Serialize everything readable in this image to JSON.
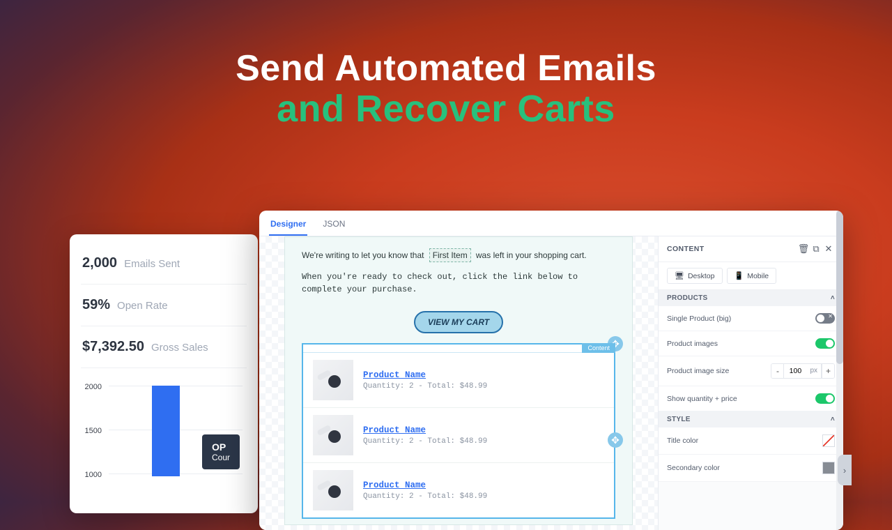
{
  "headline": {
    "line1": "Send Automated Emails",
    "line2": "and Recover Carts"
  },
  "stats": {
    "emails_sent": {
      "value": "2,000",
      "label": "Emails Sent"
    },
    "open_rate": {
      "value": "59%",
      "label": "Open Rate"
    },
    "gross_sales": {
      "value": "$7,392.50",
      "label": "Gross Sales"
    }
  },
  "chart_data": {
    "type": "bar",
    "y_ticks": [
      "2000",
      "1500",
      "1000"
    ],
    "ylim": [
      1000,
      2000
    ],
    "series": [
      {
        "name": "",
        "values": [
          2000
        ]
      }
    ],
    "tooltip": {
      "title": "OP",
      "subtitle": "Cour"
    }
  },
  "designer": {
    "tabs": [
      "Designer",
      "JSON"
    ],
    "active_tab": "Designer",
    "mail_line1_a": "We're writing to let you know that",
    "mail_tag": "First Item",
    "mail_line1_b": "was left in your shopping cart.",
    "mail_line2": "When you're ready to check out, click the link below to complete your purchase.",
    "cta": "VIEW MY CART",
    "content_badge": "Content",
    "products": [
      {
        "name": "Product Name",
        "meta": "Quantity: 2 - Total: $48.99"
      },
      {
        "name": "Product Name",
        "meta": "Quantity: 2 - Total: $48.99"
      },
      {
        "name": "Product Name",
        "meta": "Quantity: 2 - Total: $48.99"
      }
    ]
  },
  "panel": {
    "header": "CONTENT",
    "device": {
      "desktop": "Desktop",
      "mobile": "Mobile"
    },
    "sections": {
      "products": {
        "title": "PRODUCTS",
        "single_product": {
          "label": "Single Product (big)",
          "on": false
        },
        "product_images": {
          "label": "Product images",
          "on": true
        },
        "image_size": {
          "label": "Product image size",
          "value": "100",
          "unit": "px"
        },
        "show_qty_price": {
          "label": "Show quantity + price",
          "on": true
        }
      },
      "style": {
        "title": "STYLE",
        "title_color": {
          "label": "Title color"
        },
        "secondary_color": {
          "label": "Secondary color"
        }
      }
    }
  }
}
